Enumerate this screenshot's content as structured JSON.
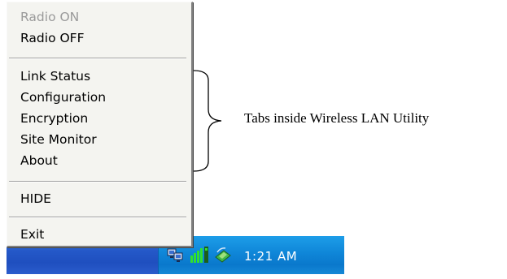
{
  "menu": {
    "items": [
      {
        "label": "Radio ON",
        "disabled": true
      },
      {
        "label": "Radio OFF"
      },
      {
        "label": "Link Status"
      },
      {
        "label": "Configuration"
      },
      {
        "label": "Encryption"
      },
      {
        "label": "Site Monitor"
      },
      {
        "label": "About"
      },
      {
        "label": "HIDE"
      },
      {
        "label": "Exit"
      }
    ]
  },
  "annotation": {
    "text": "Tabs inside Wireless LAN Utility"
  },
  "taskbar": {
    "clock": "1:21 AM",
    "tray_icons": [
      "network-computers-icon",
      "signal-strength-icon",
      "wireless-adapter-icon"
    ]
  },
  "colors": {
    "taskbar_blue": "#2458c8",
    "tray_blue": "#0f86d8",
    "menu_bg": "#f4f4f0",
    "disabled_text": "#9a9a9a"
  }
}
